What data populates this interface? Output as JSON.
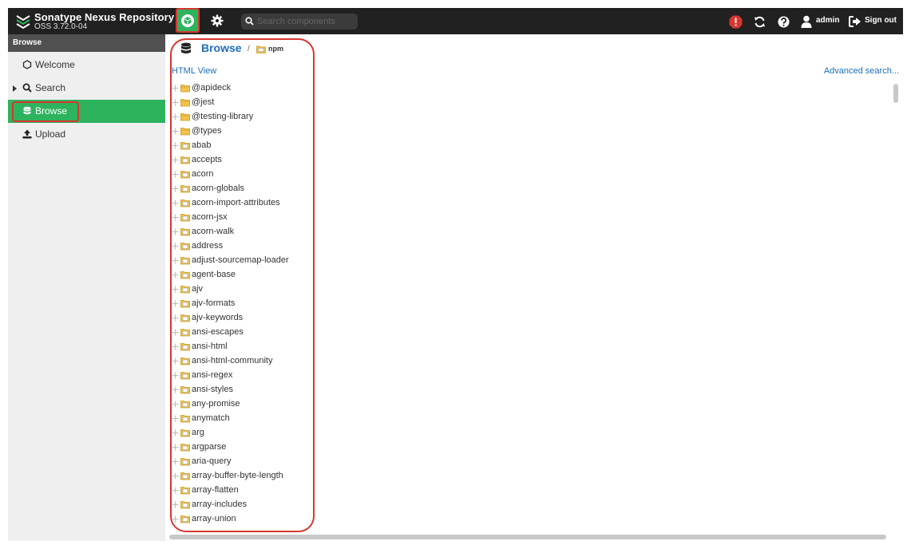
{
  "app": {
    "name": "Sonatype Nexus Repository",
    "version": "OSS 3.72.0-04"
  },
  "toolbar": {
    "search_placeholder": "Search components",
    "user": "admin",
    "sign_out_label": "Sign out"
  },
  "sidebar": {
    "header": "Browse",
    "items": [
      {
        "label": "Welcome",
        "icon": "hexagon-icon"
      },
      {
        "label": "Search",
        "icon": "search-icon"
      },
      {
        "label": "Browse",
        "icon": "database-icon"
      },
      {
        "label": "Upload",
        "icon": "upload-icon"
      }
    ]
  },
  "breadcrumb": {
    "title": "Browse",
    "separator": "/",
    "repository": "npm"
  },
  "links": {
    "html_view": "HTML View",
    "advanced_search": "Advanced search..."
  },
  "tree": [
    {
      "name": "@apideck",
      "type": "folder"
    },
    {
      "name": "@jest",
      "type": "folder"
    },
    {
      "name": "@testing-library",
      "type": "folder"
    },
    {
      "name": "@types",
      "type": "folder"
    },
    {
      "name": "abab",
      "type": "component"
    },
    {
      "name": "accepts",
      "type": "component"
    },
    {
      "name": "acorn",
      "type": "component"
    },
    {
      "name": "acorn-globals",
      "type": "component"
    },
    {
      "name": "acorn-import-attributes",
      "type": "component"
    },
    {
      "name": "acorn-jsx",
      "type": "component"
    },
    {
      "name": "acorn-walk",
      "type": "component"
    },
    {
      "name": "address",
      "type": "component"
    },
    {
      "name": "adjust-sourcemap-loader",
      "type": "component"
    },
    {
      "name": "agent-base",
      "type": "component"
    },
    {
      "name": "ajv",
      "type": "component"
    },
    {
      "name": "ajv-formats",
      "type": "component"
    },
    {
      "name": "ajv-keywords",
      "type": "component"
    },
    {
      "name": "ansi-escapes",
      "type": "component"
    },
    {
      "name": "ansi-html",
      "type": "component"
    },
    {
      "name": "ansi-html-community",
      "type": "component"
    },
    {
      "name": "ansi-regex",
      "type": "component"
    },
    {
      "name": "ansi-styles",
      "type": "component"
    },
    {
      "name": "any-promise",
      "type": "component"
    },
    {
      "name": "anymatch",
      "type": "component"
    },
    {
      "name": "arg",
      "type": "component"
    },
    {
      "name": "argparse",
      "type": "component"
    },
    {
      "name": "aria-query",
      "type": "component"
    },
    {
      "name": "array-buffer-byte-length",
      "type": "component"
    },
    {
      "name": "array-flatten",
      "type": "component"
    },
    {
      "name": "array-includes",
      "type": "component"
    },
    {
      "name": "array-union",
      "type": "component"
    }
  ],
  "colors": {
    "accent": "#2db35d",
    "topbar": "#212121",
    "link": "#1f6eb8",
    "highlight": "#d9362f",
    "alert": "#d9362f"
  }
}
